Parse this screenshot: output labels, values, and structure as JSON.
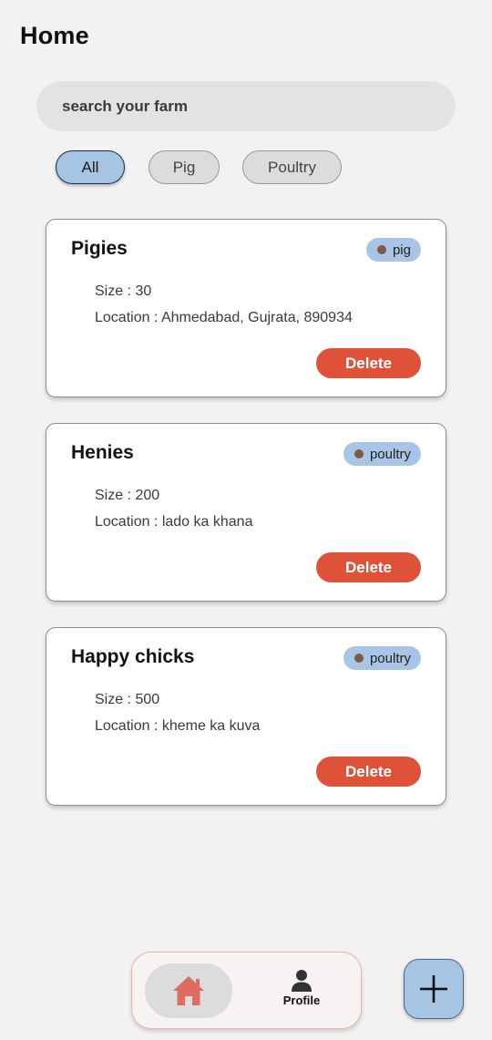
{
  "header": {
    "title": "Home"
  },
  "search": {
    "placeholder": "search your farm",
    "value": ""
  },
  "filters": {
    "selected": "All",
    "chips": [
      {
        "label": "All",
        "active": true
      },
      {
        "label": "Pig",
        "active": false
      },
      {
        "label": "Poultry",
        "active": false
      }
    ]
  },
  "farms": [
    {
      "name": "Pigies",
      "type": "pig",
      "size_text": "Size : 30",
      "location_text": "Location : Ahmedabad, Gujrata, 890934",
      "delete_label": "Delete"
    },
    {
      "name": "Henies",
      "type": "poultry",
      "size_text": "Size : 200",
      "location_text": "Location : lado ka khana",
      "delete_label": "Delete"
    },
    {
      "name": "Happy chicks",
      "type": "poultry",
      "size_text": "Size : 500",
      "location_text": "Location : kheme ka kuva",
      "delete_label": "Delete"
    }
  ],
  "bottom_nav": {
    "items": [
      {
        "icon": "home-icon",
        "label": "",
        "active": true
      },
      {
        "icon": "person-icon",
        "label": "Profile",
        "active": false
      }
    ]
  },
  "fab": {
    "icon": "plus-icon"
  },
  "colors": {
    "background": "#f2f2f3",
    "accent_blue": "#a6c4e4",
    "delete_red": "#de5239",
    "home_icon": "#e06b63",
    "badge_dot": "#7d5a46"
  }
}
